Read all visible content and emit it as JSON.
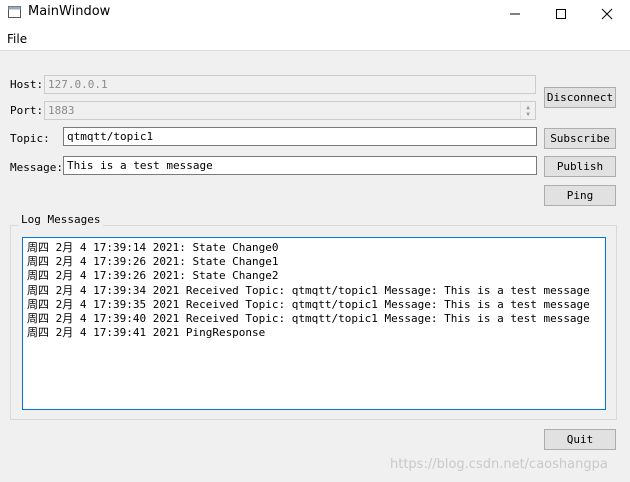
{
  "window": {
    "title": "MainWindow"
  },
  "menu": {
    "file": "File"
  },
  "form": {
    "host_label": "Host:",
    "host_value": "127.0.0.1",
    "port_label": "Port:",
    "port_value": "1883",
    "topic_label": "Topic:",
    "topic_value": "qtmqtt/topic1",
    "message_label": "Message:",
    "message_value": "This is a test message"
  },
  "buttons": {
    "disconnect": "Disconnect",
    "subscribe": "Subscribe",
    "publish": "Publish",
    "ping": "Ping",
    "quit": "Quit"
  },
  "log": {
    "title": "Log Messages",
    "lines": [
      "周四 2月 4 17:39:14 2021: State Change0",
      "周四 2月 4 17:39:26 2021: State Change1",
      "周四 2月 4 17:39:26 2021: State Change2",
      "周四 2月 4 17:39:34 2021 Received Topic: qtmqtt/topic1 Message: This is a test message",
      "周四 2月 4 17:39:35 2021 Received Topic: qtmqtt/topic1 Message: This is a test message",
      "周四 2月 4 17:39:40 2021 Received Topic: qtmqtt/topic1 Message: This is a test message",
      "周四 2月 4 17:39:41 2021 PingResponse"
    ]
  },
  "watermark": "https://blog.csdn.net/caoshangpa",
  "icons": {
    "app": "qt-window-icon",
    "minimize": "minimize-icon",
    "maximize": "maximize-icon",
    "close": "close-icon",
    "spin_up": "chevron-up-icon",
    "spin_down": "chevron-down-icon"
  },
  "colors": {
    "accent": "#0078d7",
    "background": "#f0f0f0"
  }
}
